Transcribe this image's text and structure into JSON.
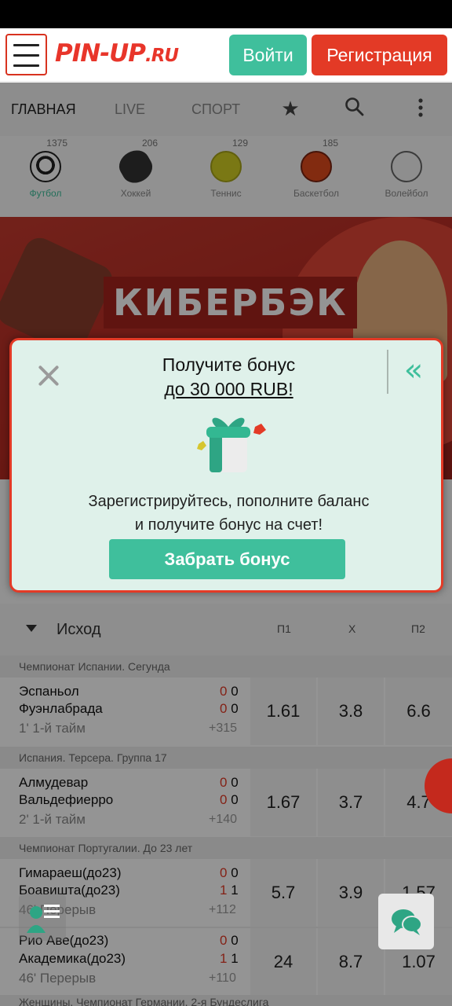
{
  "header": {
    "logo_main": "PIN-UP",
    "logo_suffix": ".RU",
    "login_label": "Войти",
    "register_label": "Регистрация"
  },
  "nav": {
    "items": [
      "ГЛАВНАЯ",
      "LIVE",
      "СПОРТ"
    ],
    "icons": [
      "star-icon",
      "search-icon",
      "more-vertical-icon"
    ]
  },
  "sports": [
    {
      "name": "Футбол",
      "count": "1375",
      "icon": "football-icon",
      "active": true
    },
    {
      "name": "Хоккей",
      "count": "206",
      "icon": "hockey-puck-icon"
    },
    {
      "name": "Теннис",
      "count": "129",
      "icon": "tennis-ball-icon"
    },
    {
      "name": "Баскетбол",
      "count": "185",
      "icon": "basketball-icon"
    },
    {
      "name": "Волейбол",
      "count": "",
      "icon": "volleyball-icon"
    }
  ],
  "banner": {
    "title": "КИБЕРБЭК"
  },
  "table": {
    "header": {
      "title": "Исход",
      "cols": [
        "П1",
        "Х",
        "П2"
      ]
    },
    "matches": [
      {
        "league": "Чемпионат Испании. Сегунда",
        "team1": "Эспаньол",
        "team2": "Фуэнлабрада",
        "score1": [
          "0",
          "0"
        ],
        "score2": [
          "0",
          "0"
        ],
        "status": "1' 1-й тайм",
        "more": "+315",
        "odds": [
          "1.61",
          "3.8",
          "6.6"
        ]
      },
      {
        "league": "Испания. Терсера. Группа 17",
        "team1": "Алмудевар",
        "team2": "Вальдефиерро",
        "score1": [
          "0",
          "0"
        ],
        "score2": [
          "0",
          "0"
        ],
        "status": "2' 1-й тайм",
        "more": "+140",
        "odds": [
          "1.67",
          "3.7",
          "4.7"
        ]
      },
      {
        "league": "Чемпионат Португалии. До 23 лет",
        "team1": "Гимараеш(до23)",
        "team2": "Боавишта(до23)",
        "score1": [
          "0",
          "0"
        ],
        "score2": [
          "1",
          "1"
        ],
        "status": "46' Перерыв",
        "more": "+112",
        "odds": [
          "5.7",
          "3.9",
          "1.57"
        ]
      },
      {
        "league": "",
        "team1": "Рио Аве(до23)",
        "team2": "Академика(до23)",
        "score1": [
          "0",
          "0"
        ],
        "score2": [
          "1",
          "1"
        ],
        "status": "46' Перерыв",
        "more": "+110",
        "odds": [
          "24",
          "8.7",
          "1.07"
        ]
      }
    ],
    "next_league": "Женщины. Чемпионат Германии. 2-я Бундеслига"
  },
  "modal": {
    "title": "Получите бонус",
    "subtitle": "до 30 000 RUB!",
    "text_line1": "Зарегистрируйтесь, пополните баланс",
    "text_line2": "и получите бонус на счет!",
    "button_label": "Забрать бонус"
  },
  "colors": {
    "brand_red": "#e33a26",
    "accent_green": "#3fbf9c",
    "modal_bg": "#dff1ea"
  }
}
